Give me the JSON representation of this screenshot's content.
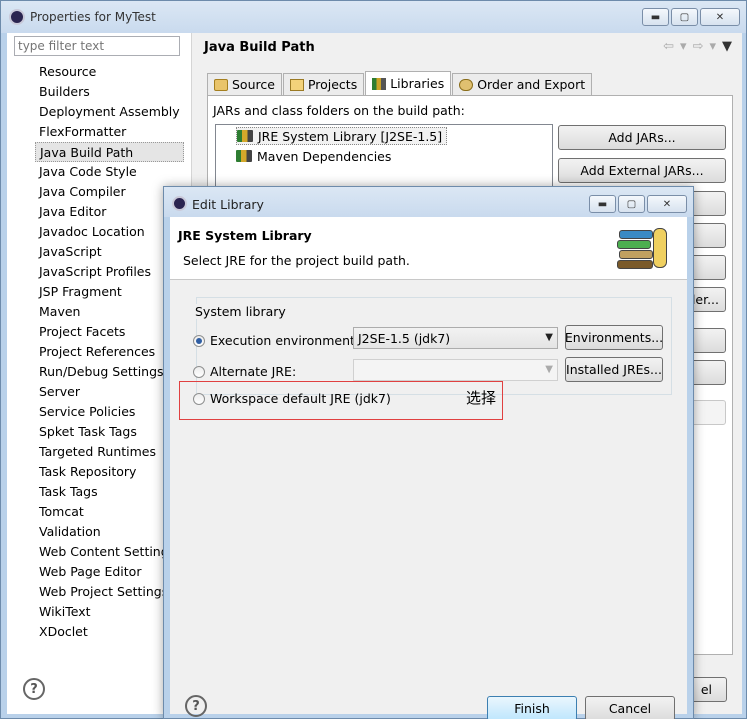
{
  "main_window": {
    "title": "Properties for MyTest",
    "filter_placeholder": "type filter text",
    "nav_items": [
      "Resource",
      "Builders",
      "Deployment Assembly",
      "FlexFormatter",
      "Java Build Path",
      "Java Code Style",
      "Java Compiler",
      "Java Editor",
      "Javadoc Location",
      "JavaScript",
      "JavaScript Profiles",
      "JSP Fragment",
      "Maven",
      "Project Facets",
      "Project References",
      "Run/Debug Settings",
      "Server",
      "Service Policies",
      "Spket Task Tags",
      "Targeted Runtimes",
      "Task Repository",
      "Task Tags",
      "Tomcat",
      "Validation",
      "Web Content Settings",
      "Web Page Editor",
      "Web Project Settings",
      "WikiText",
      "XDoclet"
    ],
    "selected_nav_index": 4,
    "pane_title": "Java Build Path",
    "tabs": [
      "Source",
      "Projects",
      "Libraries",
      "Order and Export"
    ],
    "active_tab": "Libraries",
    "jars_label": "JARs and class folders on the build path:",
    "jar_items": [
      "JRE System Library [J2SE-1.5]",
      "Maven Dependencies"
    ],
    "buttons": {
      "add_jars": "Add JARs...",
      "add_external_jars": "Add External JARs...",
      "partial_folder": "der...",
      "cancel_partial": "el"
    }
  },
  "dialog": {
    "title": "Edit Library",
    "heading": "JRE System Library",
    "description": "Select JRE for the project build path.",
    "group_label": "System library",
    "options": {
      "execution_env_label": "Execution environment:",
      "execution_env_value": "J2SE-1.5 (jdk7)",
      "alternate_jre_label": "Alternate JRE:",
      "alternate_jre_value": "",
      "workspace_default_label": "Workspace default JRE (jdk7)"
    },
    "selected_option": "execution_env",
    "buttons": {
      "environments": "Environments...",
      "installed_jres": "Installed JREs...",
      "finish": "Finish",
      "cancel": "Cancel"
    },
    "annotation": "选择",
    "annotation_color": "#e04040"
  }
}
